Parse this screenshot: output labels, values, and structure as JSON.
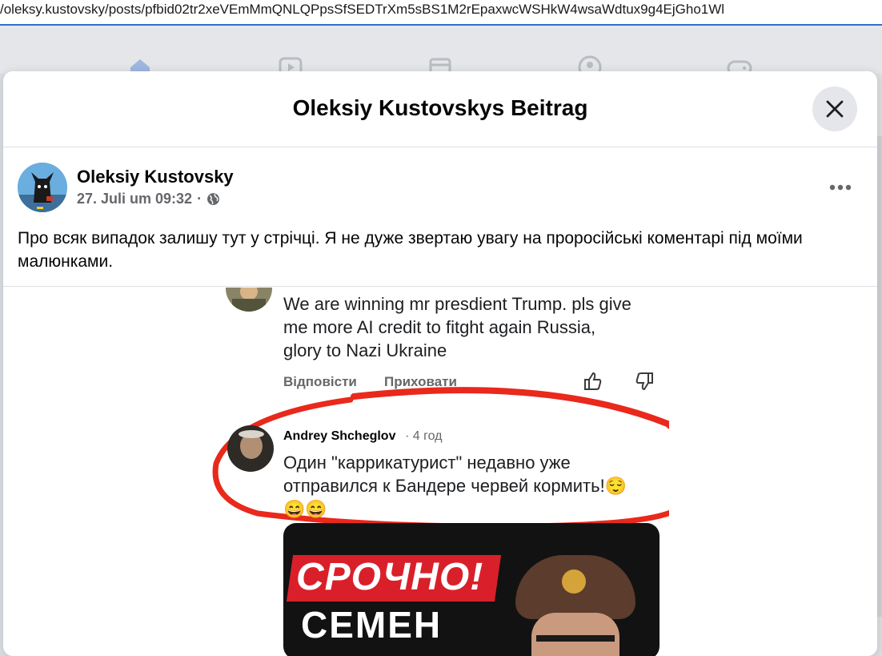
{
  "browser": {
    "url": "/oleksy.kustovsky/posts/pfbid02tr2xeVEmMmQNLQPpsSfSEDTrXm5sBS1M2rEpaxwcWSHkW4wsaWdtux9g4EjGho1Wl"
  },
  "nav": {
    "icons": [
      "home-icon",
      "video-icon",
      "marketplace-icon",
      "groups-icon",
      "gaming-icon"
    ]
  },
  "modal": {
    "title": "Oleksiy Kustovskys Beitrag",
    "close_icon": "close-icon"
  },
  "post": {
    "author": "Oleksiy Kustovsky",
    "date": "27. Juli um 09:32",
    "separator": "·",
    "audience_icon": "globe-icon",
    "more_icon": "more-icon",
    "text": "Про всяк випадок залишу тут у стрічці. Я не дуже звертаю увагу на проросійські коментарі під моїми малюнками."
  },
  "embedded": {
    "comment1": {
      "text_line1": "We are winning mr presdient Trump. pls give",
      "text_line2": "me more AI credit to fitght again Russia,",
      "text_line3": "glory to Nazi Ukraine",
      "reply_label": "Відповісти",
      "hide_label": "Приховати"
    },
    "comment2": {
      "author": "Andrey Shcheglov",
      "time": "· 4 год",
      "text_line1": "Один \"каррикатурист\" недавно уже",
      "text_line2": "отправился к Бандере червей кормить!😌",
      "text_line3": "😄😄"
    },
    "news_card": {
      "headline": "СРОЧНО!",
      "subline": "СЕМЕН"
    },
    "highlight_color": "#e8291c"
  }
}
